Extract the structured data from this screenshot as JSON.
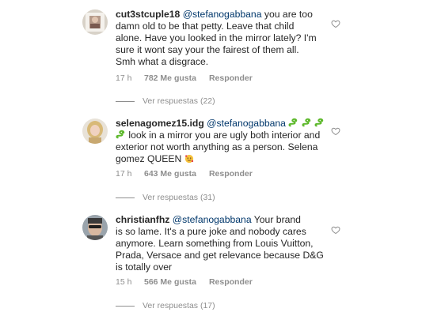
{
  "comments": [
    {
      "username": "cut3stcuple18",
      "mention": "@stefanogabbana",
      "lines": [
        " you are too",
        "damn old to be that petty. Leave that child",
        "alone. Have you looked in the mirror lately?  I'm",
        "sure it wont say your the fairest of them all.",
        "Smh what a disgrace."
      ],
      "time": "17 h",
      "likes": "782 Me gusta",
      "reply": "Responder",
      "view_replies": "Ver respuestas (22)",
      "avatar_icon": "portrait-photo"
    },
    {
      "username": "selenagomez15.idg",
      "mention": "@stefanogabbana",
      "emoji_snake": "🐍",
      "lines": [
        "",
        " look in a mirror you are ugly both interior and",
        "exterior not worth anything as a person.  Selena",
        "gomez QUEEN "
      ],
      "emoji_face": "🥰",
      "time": "17 h",
      "likes": "643 Me gusta",
      "reply": "Responder",
      "view_replies": "Ver respuestas (31)",
      "avatar_icon": "blonde-portrait-photo"
    },
    {
      "username": "christianfhz",
      "mention": "@stefanogabbana",
      "lines": [
        " Your brand",
        "is so lame. It's a pure joke and nobody cares",
        "anymore. Learn something from Louis Vuitton,",
        "Prada, Versace and get relevance because D&G",
        "is totally over"
      ],
      "time": "15 h",
      "likes": "566 Me gusta",
      "reply": "Responder",
      "view_replies": "Ver respuestas (17)",
      "avatar_icon": "sunglasses-portrait-photo"
    }
  ],
  "colors": {
    "text": "#262626",
    "mention": "#00376b",
    "meta": "#8e8e8e",
    "snake_green": "#5cb82a"
  }
}
